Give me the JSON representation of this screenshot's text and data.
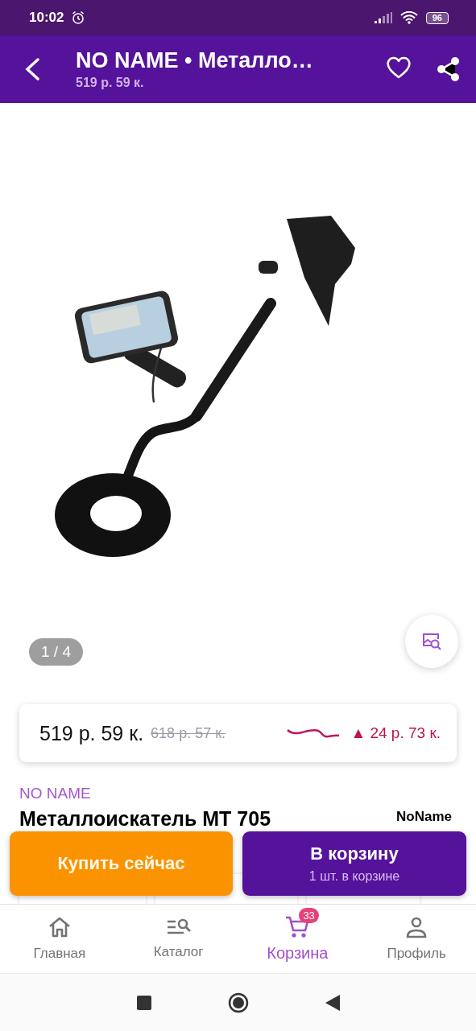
{
  "status_bar": {
    "time": "10:02",
    "battery": "96"
  },
  "app_bar": {
    "title": "NO NAME • Металло…",
    "subtitle": "519 р. 59 к."
  },
  "gallery": {
    "counter": "1 / 4"
  },
  "price_card": {
    "price": "519 р. 59 к.",
    "old_price": "618 р. 57 к.",
    "change": "▲ 24 р. 73 к."
  },
  "product": {
    "brand": "NO NAME",
    "title": "Металлоискатель МТ 705",
    "seller": "NoName"
  },
  "actions": [
    {
      "kind": "buy",
      "label": "Купить сейчас"
    },
    {
      "kind": "cart",
      "label": "В корзину",
      "sublabel": "1 шт. в корзине"
    }
  ],
  "bottom_nav": [
    {
      "kind": "home",
      "label": "Главная",
      "selected": false
    },
    {
      "kind": "catalog",
      "label": "Каталог",
      "selected": false
    },
    {
      "kind": "cart",
      "label": "Корзина",
      "selected": true,
      "badge": "33"
    },
    {
      "kind": "profile",
      "label": "Профиль",
      "selected": false
    }
  ]
}
